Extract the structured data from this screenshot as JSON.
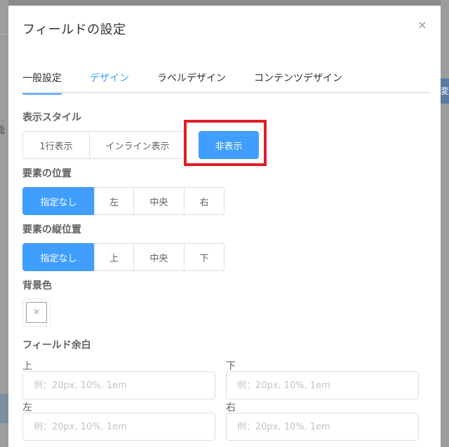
{
  "backdrop": {
    "left_fragment": "能",
    "right_fragment": "変"
  },
  "modal": {
    "title": "フィールドの設定",
    "close_glyph": "×"
  },
  "tabs": [
    {
      "label": "一般設定"
    },
    {
      "label": "デザイン"
    },
    {
      "label": "ラベルデザイン"
    },
    {
      "label": "コンテンツデザイン"
    }
  ],
  "display_style": {
    "label": "表示スタイル",
    "options": [
      "1行表示",
      "インライン表示",
      "非表示"
    ],
    "selected": "非表示"
  },
  "element_position": {
    "label": "要素の位置",
    "options": [
      "指定なし",
      "左",
      "中央",
      "右"
    ],
    "selected": "指定なし"
  },
  "element_vertical_position": {
    "label": "要素の縦位置",
    "options": [
      "指定なし",
      "上",
      "中央",
      "下"
    ],
    "selected": "指定なし"
  },
  "background_color": {
    "label": "背景色",
    "empty_glyph": "×"
  },
  "field_margin": {
    "label": "フィールド余白",
    "top": {
      "label": "上",
      "placeholder": "例：20px, 10%, 1em"
    },
    "bottom": {
      "label": "下",
      "placeholder": "例：20px, 10%, 1em"
    },
    "left": {
      "label": "左",
      "placeholder": "例：20px, 10%, 1em"
    },
    "right": {
      "label": "右",
      "placeholder": "例：20px, 10%, 1em"
    }
  },
  "colors": {
    "primary": "#409eff",
    "highlight": "#e21d29",
    "border": "#dcdfe6"
  }
}
